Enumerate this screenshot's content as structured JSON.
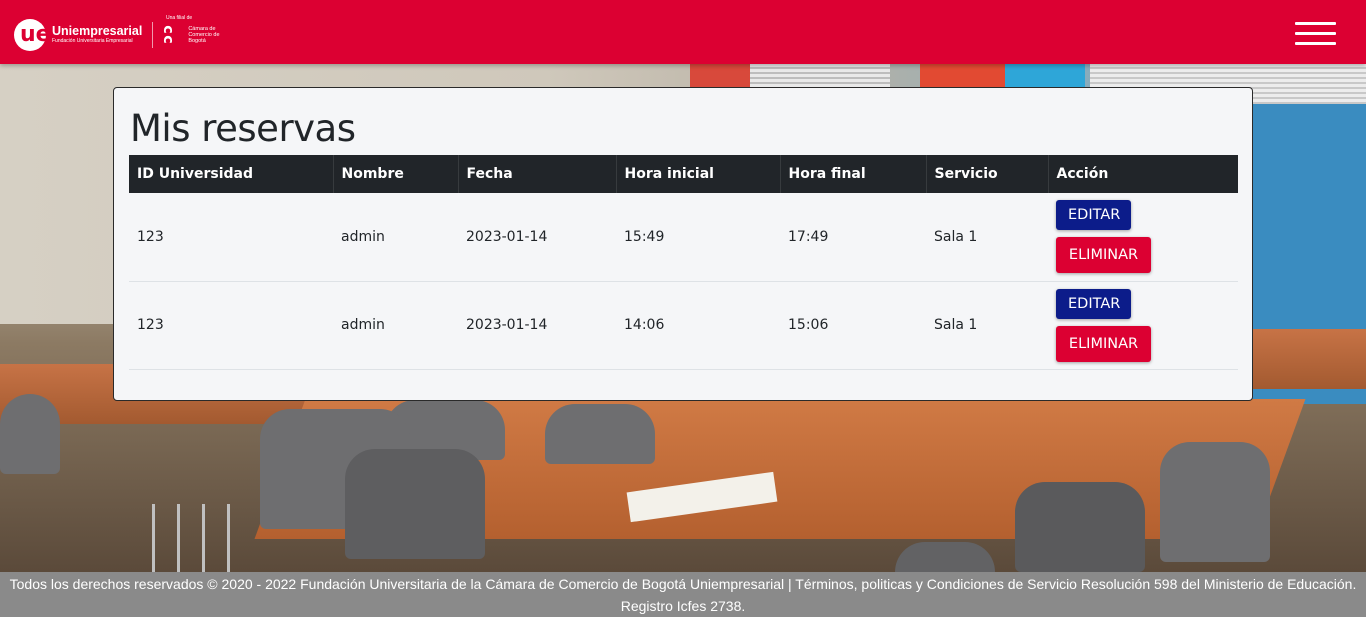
{
  "header": {
    "logo_mark": "ue",
    "logo_name": "Uniempresarial",
    "logo_subtitle": "Fundación Universitaria Empresarial",
    "ccb_tag": "Una filial de",
    "ccb_text": "Cámara de Comercio de Bogotá",
    "brand_color": "#dc0032"
  },
  "page": {
    "title": "Mis reservas"
  },
  "table": {
    "columns": [
      "ID Universidad",
      "Nombre",
      "Fecha",
      "Hora inicial",
      "Hora final",
      "Servicio",
      "Acción"
    ],
    "rows": [
      {
        "id": "123",
        "nombre": "admin",
        "fecha": "2023-01-14",
        "hora_inicial": "15:49",
        "hora_final": "17:49",
        "servicio": "Sala 1"
      },
      {
        "id": "123",
        "nombre": "admin",
        "fecha": "2023-01-14",
        "hora_inicial": "14:06",
        "hora_final": "15:06",
        "servicio": "Sala 1"
      }
    ],
    "edit_label": "EDITAR",
    "delete_label": "ELIMINAR"
  },
  "footer": {
    "text": "Todos los derechos reservados © 2020 - 2022 Fundación Universitaria de la Cámara de Comercio de Bogotá Uniempresarial | Términos, politicas y Condiciones de Servicio Resolución 598 del Ministerio de Educación. Registro Icfes 2738."
  }
}
